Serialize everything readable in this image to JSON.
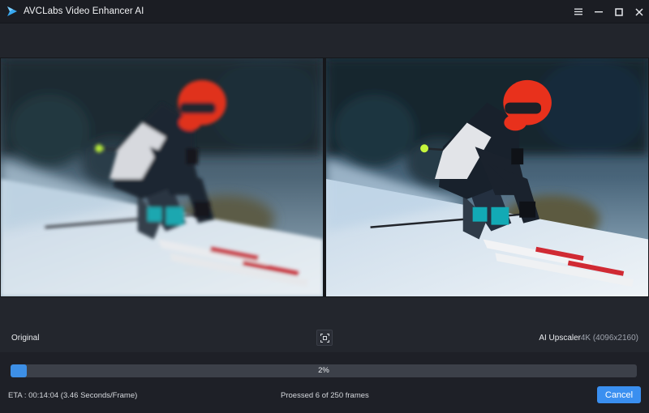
{
  "window": {
    "title": "AVCLabs Video Enhancer AI",
    "icons": [
      "app-logo-icon",
      "menu-icon",
      "minimize-icon",
      "maximize-icon",
      "close-icon"
    ]
  },
  "preview": {
    "left_label": "Original",
    "right_label": "AI Upscaler",
    "resolution": "4K (4096x2160)",
    "compare_icon": "compare-frame-icon"
  },
  "progress": {
    "percent": 2,
    "label": "2%",
    "eta": "ETA : 00:14:04 (3.46 Seconds/Frame)",
    "processed": "Proessed 6 of 250 frames",
    "cancel_label": "Cancel"
  },
  "colors": {
    "accent": "#3a8ff0",
    "background": "#1e2027",
    "helmet": "#e0301e"
  }
}
